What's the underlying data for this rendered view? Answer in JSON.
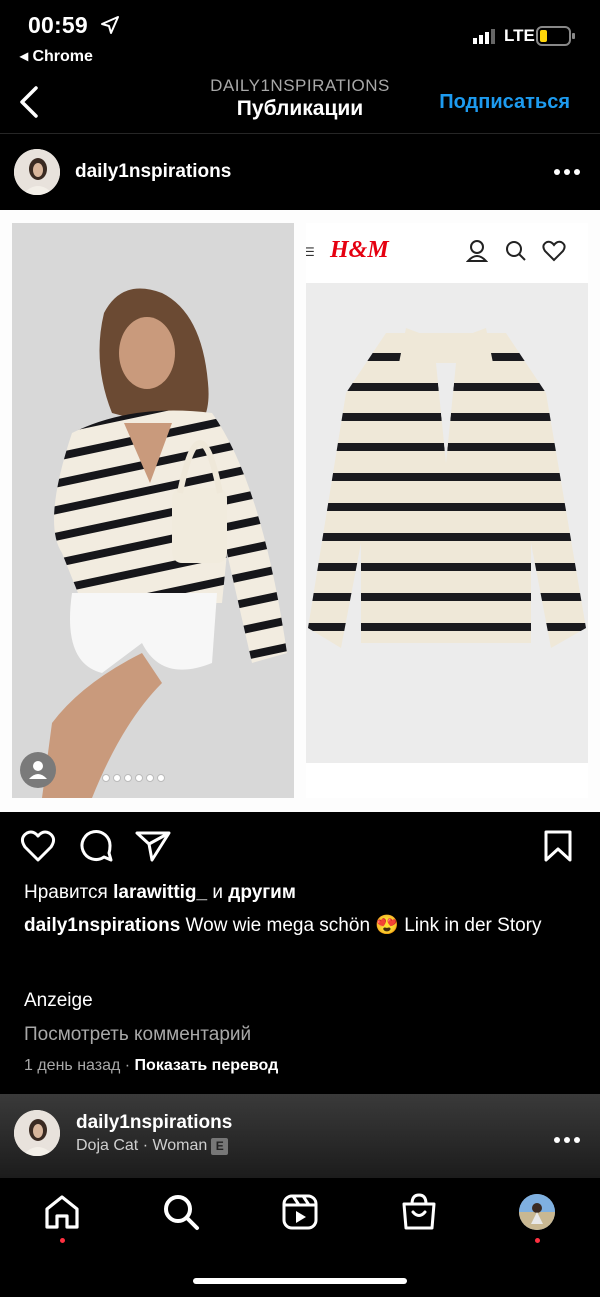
{
  "status_bar": {
    "time": "00:59",
    "back_app": "◂ Chrome",
    "network": "LTE"
  },
  "header": {
    "subtitle": "DAILY1NSPIRATIONS",
    "title": "Публикации",
    "follow": "Подписаться"
  },
  "post": {
    "username": "daily1nspirations",
    "brand_logo": "H&M",
    "carousel_dots": 6,
    "likes": {
      "prefix": "Нравится ",
      "user": "larawittig_",
      "middle": " и ",
      "suffix": "другим"
    },
    "caption": {
      "user": "daily1nspirations",
      "text": " Wow wie mega schön 😍 Link in der Story"
    },
    "sponsored": "Anzeige",
    "view_comments": "Посмотреть комментарий",
    "time_ago": "1 день назад",
    "separator": " · ",
    "translate": "Показать перевод"
  },
  "next_post": {
    "username": "daily1nspirations",
    "music": "Doja Cat · Woman",
    "explicit": "E"
  },
  "colors": {
    "accent": "#1d9bf0",
    "notification": "#ff3040"
  }
}
